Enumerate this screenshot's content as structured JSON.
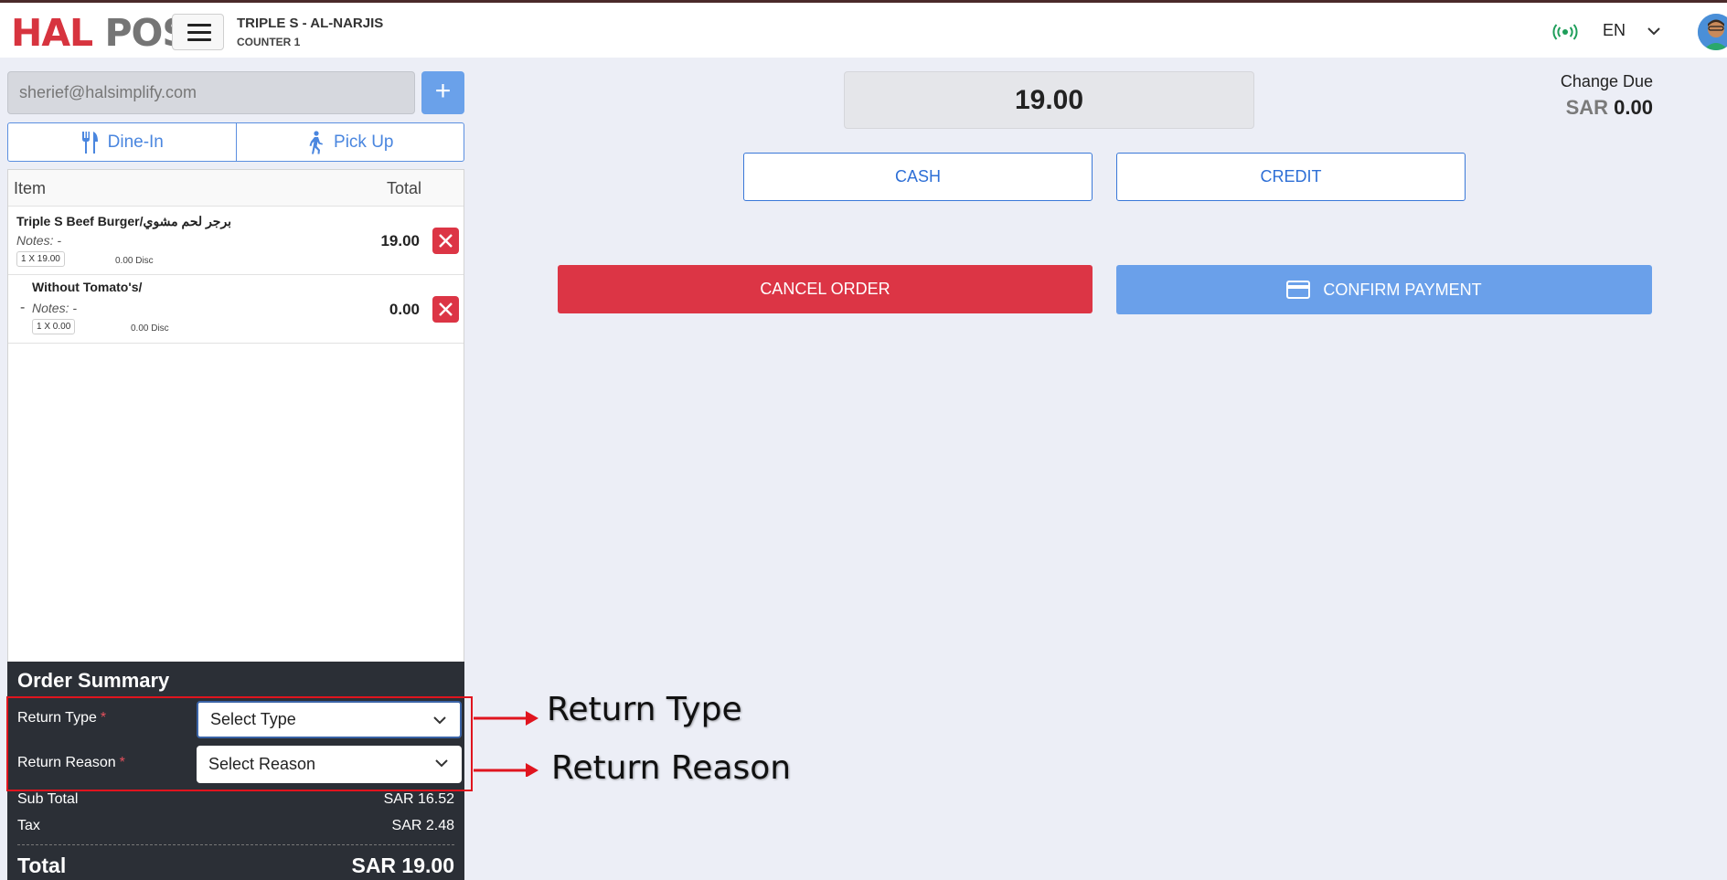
{
  "header": {
    "logo_part1": "HAL",
    "logo_part2": "POS",
    "store_name": "TRIPLE S - AL-NARJIS",
    "counter": "COUNTER 1",
    "language": "EN"
  },
  "customer": {
    "email": "sherief@halsimplify.com",
    "add_label": "+"
  },
  "order_modes": {
    "dine_in": "Dine-In",
    "pick_up": "Pick Up"
  },
  "items_table": {
    "col_item": "Item",
    "col_total": "Total",
    "rows": [
      {
        "name": "Triple S Beef Burger/برجر لحم مشوي",
        "notes": "Notes: -",
        "qty": "1 X 19.00",
        "disc": "0.00 Disc",
        "total": "19.00"
      },
      {
        "name": "Without Tomato's/",
        "prefix": "-",
        "notes": "Notes: -",
        "qty": "1 X 0.00",
        "disc": "0.00 Disc",
        "total": "0.00"
      }
    ]
  },
  "summary": {
    "title": "Order Summary",
    "return_type_label": "Return Type",
    "return_type_value": "Select Type",
    "return_reason_label": "Return Reason",
    "return_reason_value": "Select Reason",
    "required_mark": "*",
    "subtotal_label": "Sub Total",
    "subtotal_value": "SAR 16.52",
    "tax_label": "Tax",
    "tax_value": "SAR 2.48",
    "total_label": "Total",
    "total_value": "SAR 19.00"
  },
  "annotations": {
    "return_type": "Return Type",
    "return_reason": "Return Reason"
  },
  "payment": {
    "amount": "19.00",
    "change_due_label": "Change Due",
    "change_currency": "SAR",
    "change_value": "0.00",
    "cash_label": "CASH",
    "credit_label": "CREDIT",
    "cancel_label": "CANCEL ORDER",
    "confirm_label": "CONFIRM PAYMENT"
  },
  "colors": {
    "accent": "#6aa0ea",
    "danger": "#dc3545",
    "annotation": "#e0141e"
  }
}
